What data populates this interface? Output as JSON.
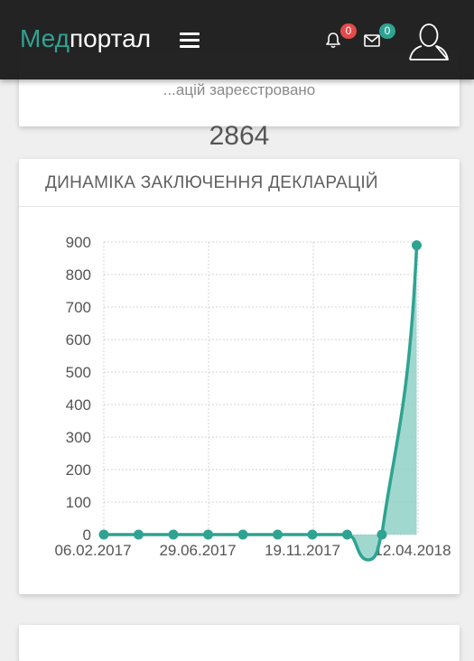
{
  "navbar": {
    "brand_part1": "Мед",
    "brand_part2": "портал",
    "notifications_count": "0",
    "messages_count": "0"
  },
  "stats_card": {
    "title": "...ацій зареєстровано",
    "value": "2864"
  },
  "chart_card": {
    "title": "ДИНАМІКА ЗАКЛЮЧЕННЯ ДЕКЛАРАЦІЙ"
  },
  "colors": {
    "accent": "#2fa391",
    "fill": "#8fd0c5",
    "navbar": "#161616",
    "badge_red": "#e24b4b"
  },
  "chart_data": {
    "type": "area",
    "title": "ДИНАМІКА ЗАКЛЮЧЕННЯ ДЕКЛАРАЦІЙ",
    "xlabel": "",
    "ylabel": "",
    "ylim": [
      0,
      900
    ],
    "y_ticks": [
      "0",
      "100",
      "200",
      "300",
      "400",
      "500",
      "600",
      "700",
      "800",
      "900"
    ],
    "x_tick_labels": [
      "06.02.2017",
      "29.06.2017",
      "19.11.2017",
      "12.04.2018"
    ],
    "grid": true,
    "series": [
      {
        "values": [
          0,
          0,
          0,
          0,
          0,
          0,
          0,
          0,
          0,
          890
        ]
      }
    ]
  }
}
